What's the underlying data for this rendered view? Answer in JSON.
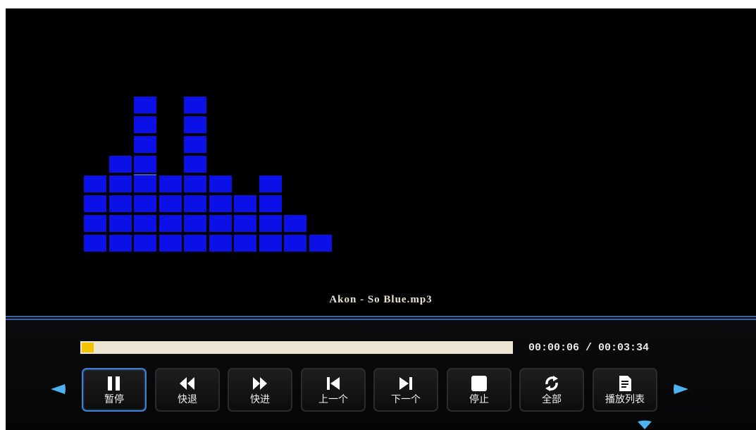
{
  "track": {
    "title": "Akon - So Blue.mp3"
  },
  "playback": {
    "elapsed": "00:00:06",
    "duration": "00:03:34",
    "time_display": "00:00:06 / 00:03:34",
    "progress_fraction": 0.028
  },
  "visualizer": {
    "bar_levels": [
      4,
      5,
      8,
      4,
      8,
      4,
      3,
      4,
      2,
      1
    ],
    "peak_markers": [
      null,
      null,
      4,
      null,
      null,
      null,
      null,
      null,
      null,
      null
    ]
  },
  "controls": [
    {
      "id": "pause",
      "label": "暂停",
      "icon": "pause-icon",
      "active": true
    },
    {
      "id": "rewind",
      "label": "快退",
      "icon": "rewind-icon",
      "active": false
    },
    {
      "id": "fast-forward",
      "label": "快进",
      "icon": "fast-forward-icon",
      "active": false
    },
    {
      "id": "previous",
      "label": "上一个",
      "icon": "skip-previous-icon",
      "active": false
    },
    {
      "id": "next",
      "label": "下一个",
      "icon": "skip-next-icon",
      "active": false
    },
    {
      "id": "stop",
      "label": "停止",
      "icon": "stop-icon",
      "active": false
    },
    {
      "id": "repeat-all",
      "label": "全部",
      "icon": "repeat-icon",
      "active": false
    },
    {
      "id": "playlist",
      "label": "播放列表",
      "icon": "playlist-icon",
      "active": false
    }
  ],
  "navigation": {
    "left": "arrow-left-icon",
    "right": "arrow-right-icon",
    "down": "arrow-down-icon"
  },
  "colors": {
    "background": "#000000",
    "visualizer_bar": "#0a10e6",
    "progress_fill": "#f3c300",
    "progress_track": "#ece6d2",
    "accent_border": "#3d7fd0",
    "nav_arrow": "#4ab3f0",
    "title_text": "#ece3cf"
  }
}
